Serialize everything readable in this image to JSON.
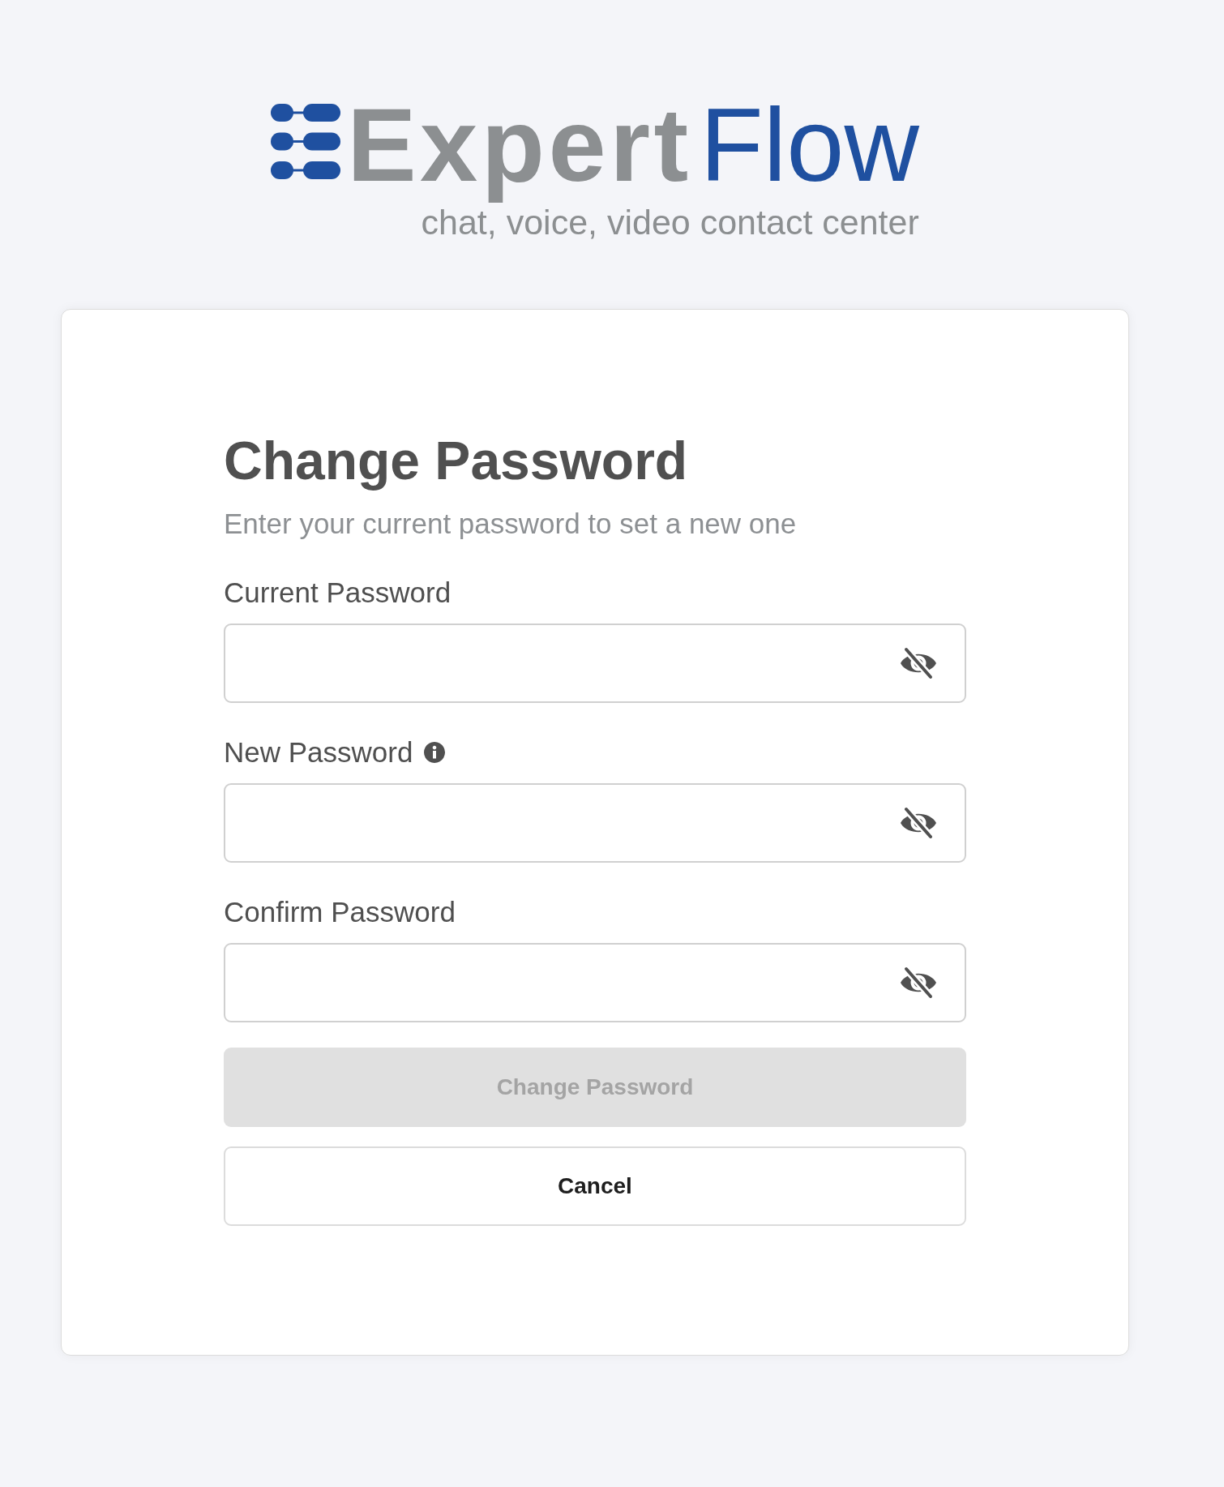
{
  "logo": {
    "wordmark": [
      {
        "text": "Expert",
        "color": "#8c8f91"
      },
      {
        "text": "Flow",
        "color": "#1f50a0"
      }
    ],
    "tagline": "chat, voice, video contact center"
  },
  "card": {
    "title": "Change Password",
    "subtitle": "Enter your current password to set a new one",
    "fields": [
      {
        "label": "Current Password",
        "info": false,
        "visible": false
      },
      {
        "label": "New Password",
        "info": true,
        "visible": false
      },
      {
        "label": "Confirm Password",
        "info": false,
        "visible": false
      }
    ],
    "buttons": [
      {
        "label": "Change Password",
        "kind": "primary",
        "disabled": true
      },
      {
        "label": "Cancel",
        "kind": "secondary",
        "disabled": false
      }
    ]
  }
}
